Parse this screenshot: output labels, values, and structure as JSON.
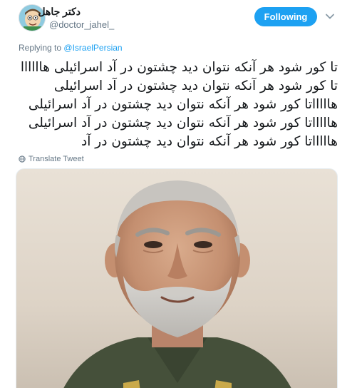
{
  "tweet": {
    "display_name": "دکتر جاهل",
    "handle": "@doctor_jahel_",
    "follow_label": "Following",
    "replying_prefix": "Replying to",
    "replying_mention": "@IsraelPersian",
    "text_lines": [
      "تا کور شود هر آنکه نتوان دید  چشتون در آد اسرائیلی هاااااا",
      "تا کور شود هر آنکه نتوان دید  چشتون در آد اسرائیلی",
      "هاااااتا کور شود هر آنکه نتوان دید  چشتون در آد اسرائیلی",
      "هاااااتا کور شود هر آنکه نتوان دید  چشتون در آد اسرائیلی",
      "هاااااتا کور شود هر آنکه نتوان دید  چشتون در آد"
    ],
    "translate_label": "Translate Tweet"
  },
  "icons": {
    "avatar": "cartoon-avatar",
    "caret": "chevron-down-icon",
    "translate": "globe-icon"
  },
  "colors": {
    "accent": "#1da1f2",
    "secondary_text": "#657786"
  }
}
